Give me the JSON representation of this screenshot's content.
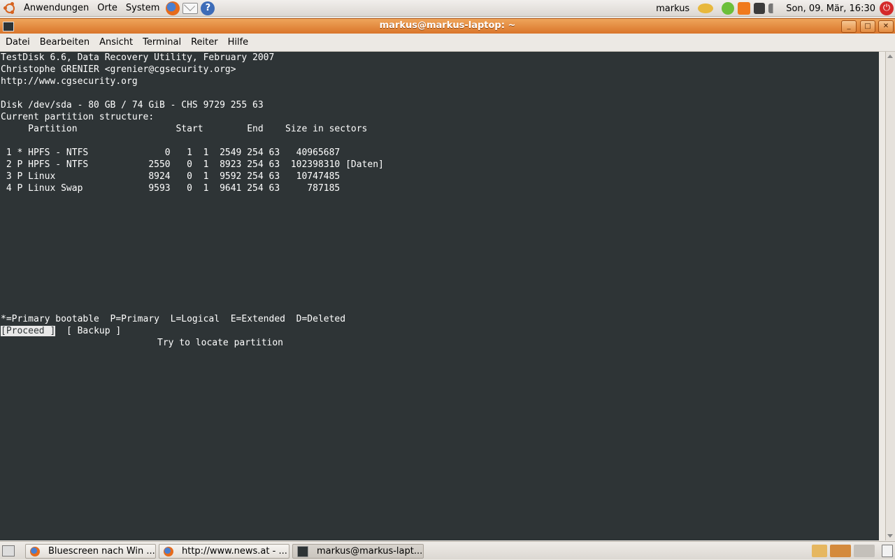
{
  "top_panel": {
    "menus": [
      "Anwendungen",
      "Orte",
      "System"
    ],
    "launchers": [
      "firefox-icon",
      "mail-icon",
      "help-icon"
    ],
    "help_glyph": "?",
    "user": "markus",
    "clock": "Son, 09. Mär, 16:30"
  },
  "window": {
    "title": "markus@markus-laptop: ~",
    "minimize": "_",
    "maximize": "□",
    "close": "✕"
  },
  "menubar": {
    "items": [
      "Datei",
      "Bearbeiten",
      "Ansicht",
      "Terminal",
      "Reiter",
      "Hilfe"
    ]
  },
  "terminal": {
    "lines": [
      "TestDisk 6.6, Data Recovery Utility, February 2007",
      "Christophe GRENIER <grenier@cgsecurity.org>",
      "http://www.cgsecurity.org",
      "",
      "Disk /dev/sda - 80 GB / 74 GiB - CHS 9729 255 63",
      "Current partition structure:",
      "     Partition                  Start        End    Size in sectors",
      "",
      " 1 * HPFS - NTFS              0   1  1  2549 254 63   40965687",
      " 2 P HPFS - NTFS           2550   0  1  8923 254 63  102398310 [Daten]",
      " 3 P Linux                 8924   0  1  9592 254 63   10747485",
      " 4 P Linux Swap            9593   0  1  9641 254 63     787185"
    ],
    "legend": "*=Primary bootable  P=Primary  L=Logical  E=Extended  D=Deleted",
    "proceed": "[Proceed ]",
    "backup": "[ Backup ]",
    "hint": "Try to locate partition"
  },
  "taskbar": {
    "tasks": [
      {
        "label": "Bluescreen nach Win ...",
        "icon": "firefox-icon"
      },
      {
        "label": "http://www.news.at - ...",
        "icon": "firefox-icon"
      },
      {
        "label": "markus@markus-lapt...",
        "icon": "terminal-icon",
        "active": true
      }
    ]
  },
  "colors": {
    "terminal_bg": "#2e3436",
    "terminal_fg": "#ffffff",
    "titlebar": "#e08a3c",
    "panel": "#ece9e4"
  }
}
